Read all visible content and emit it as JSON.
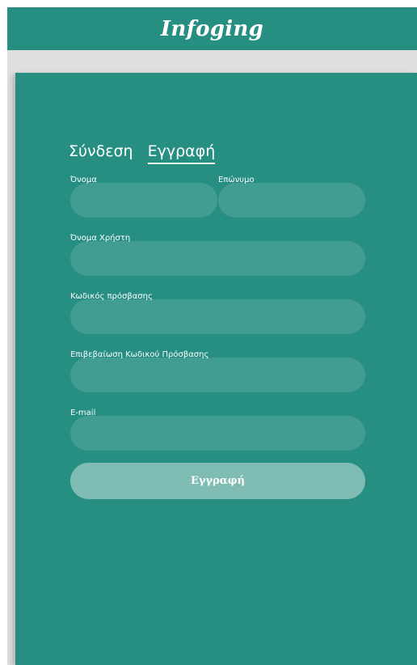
{
  "header": {
    "brand": "Infoging"
  },
  "tabs": [
    {
      "label": "Σύνδεση",
      "active": false
    },
    {
      "label": "Εγγραφή",
      "active": true
    }
  ],
  "form": {
    "first_name": {
      "label": "Όνομα",
      "value": "",
      "placeholder": ""
    },
    "last_name": {
      "label": "Επώνυμο",
      "value": "",
      "placeholder": ""
    },
    "username": {
      "label": "Όνομα Χρήστη",
      "value": "",
      "placeholder": ""
    },
    "password": {
      "label": "Κωδικός πρόσβασης",
      "value": "",
      "placeholder": ""
    },
    "password_confirm": {
      "label": "Επιβεβαίωση Κωδικού Πρόσβασης",
      "value": "",
      "placeholder": ""
    },
    "email": {
      "label": "E-mail",
      "value": "",
      "placeholder": ""
    },
    "submit_label": "Εγγραφή"
  },
  "colors": {
    "primary": "#278f82",
    "button": "#7fbcb3",
    "background_strip": "#dedede"
  }
}
